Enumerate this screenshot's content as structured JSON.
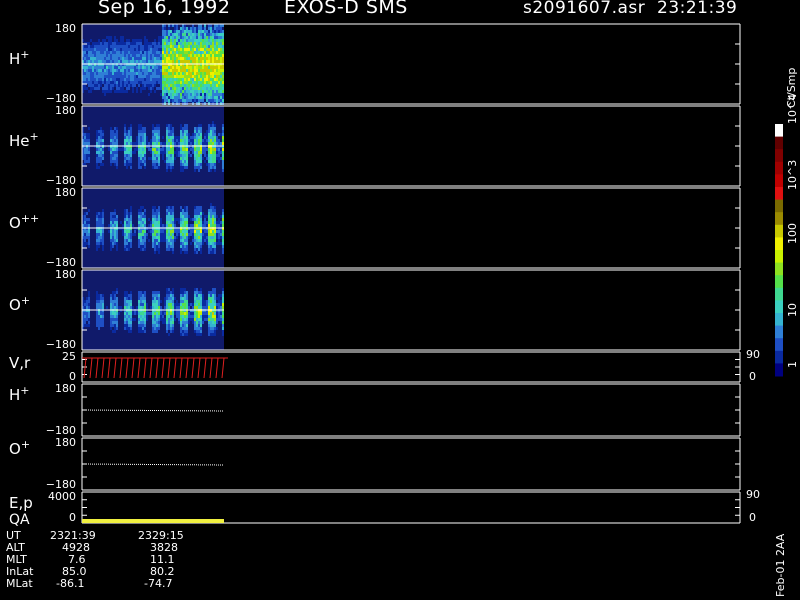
{
  "header": {
    "date": "Sep 16, 1992",
    "mission": "EXOS-D SMS",
    "file": "s2091607.asr",
    "time": "23:21:39"
  },
  "colorbar": {
    "title": "Ct/Smp",
    "tick_labels": [
      "1",
      "10",
      "100",
      "10^3",
      "10^4"
    ],
    "colors": [
      "#000080",
      "#0a2aa0",
      "#1e4fc4",
      "#2f7fd6",
      "#35b3d0",
      "#3bd0c0",
      "#3fd890",
      "#55e04a",
      "#8ee020",
      "#c8f000",
      "#f0f000",
      "#c8c800",
      "#9a8a00",
      "#7a6a00",
      "#e01010",
      "#c00000",
      "#a00000",
      "#800000",
      "#600000",
      "#ffffff"
    ]
  },
  "footer_label": "Feb-01 2AA",
  "info_block": {
    "rows": [
      {
        "label": "UT",
        "v1": "2321:39",
        "v2": "2329:15"
      },
      {
        "label": "ALT",
        "v1": "4928",
        "v2": "3828"
      },
      {
        "label": "MLT",
        "v1": "7.6",
        "v2": "11.1"
      },
      {
        "label": "InLat",
        "v1": "85.0",
        "v2": "80.2"
      },
      {
        "label": "MLat",
        "v1": "-86.1",
        "v2": "-74.7"
      }
    ]
  },
  "chart_data": [
    {
      "type": "heatmap",
      "panel": "H+ spectrogram",
      "label_base": "H",
      "label_sup": "+",
      "ylim": [
        -180,
        180
      ],
      "tick_labels": {
        "top": "180",
        "bottom": "−180"
      }
    },
    {
      "type": "heatmap",
      "panel": "He+ spectrogram",
      "label_base": "He",
      "label_sup": "+",
      "ylim": [
        -180,
        180
      ],
      "tick_labels": {
        "top": "180",
        "bottom": "−180"
      }
    },
    {
      "type": "heatmap",
      "panel": "O++ spectrogram",
      "label_base": "O",
      "label_sup": "++",
      "ylim": [
        -180,
        180
      ],
      "tick_labels": {
        "top": "180",
        "bottom": "−180"
      }
    },
    {
      "type": "heatmap",
      "panel": "O+ spectrogram",
      "label_base": "O",
      "label_sup": "+",
      "ylim": [
        -180,
        180
      ],
      "tick_labels": {
        "top": "180",
        "bottom": "−180"
      }
    },
    {
      "type": "line",
      "panel": "V,r",
      "label_base": "V,r",
      "label_sup": "",
      "ylim": [
        0,
        25
      ],
      "tick_labels": {
        "top": "25",
        "bottom": "0"
      },
      "right_ticks": {
        "top": "90",
        "bottom": "0"
      }
    },
    {
      "type": "line",
      "panel": "H+ line",
      "label_base": "H",
      "label_sup": "+",
      "ylim": [
        -180,
        180
      ],
      "tick_labels": {
        "top": "180",
        "bottom": "−180"
      }
    },
    {
      "type": "line",
      "panel": "O+ line",
      "label_base": "O",
      "label_sup": "+",
      "ylim": [
        -180,
        180
      ],
      "tick_labels": {
        "top": "180",
        "bottom": "−180"
      }
    },
    {
      "type": "line",
      "panel": "E,p QA",
      "label_base": "E,p",
      "label_sup": "",
      "label2": "QA",
      "ylim": [
        0,
        4000
      ],
      "tick_labels": {
        "top": "4000",
        "bottom": "0"
      },
      "right_ticks": {
        "top": "90",
        "bottom": "0"
      }
    }
  ]
}
